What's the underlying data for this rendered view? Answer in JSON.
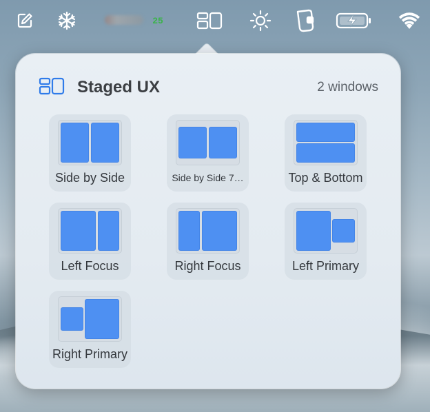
{
  "menubar": {
    "items": [
      {
        "name": "compose-icon"
      },
      {
        "name": "snowflake-icon"
      },
      {
        "name": "stats-text",
        "text": "25"
      },
      {
        "name": "staged-ux-icon"
      },
      {
        "name": "brightness-icon"
      },
      {
        "name": "phone-icon"
      },
      {
        "name": "battery-charging-icon"
      },
      {
        "name": "wifi-icon"
      }
    ],
    "stats_text": "25"
  },
  "popover": {
    "title": "Staged UX",
    "window_count": "2 windows",
    "icon": "staged-ux-icon"
  },
  "layouts": [
    {
      "label": "Side by Side",
      "icon": "side-by-side-layout"
    },
    {
      "label": "Side by Side 7…",
      "icon": "side-by-side-75-layout"
    },
    {
      "label": "Top & Bottom",
      "icon": "top-bottom-layout"
    },
    {
      "label": "Left Focus",
      "icon": "left-focus-layout"
    },
    {
      "label": "Right Focus",
      "icon": "right-focus-layout"
    },
    {
      "label": "Left Primary",
      "icon": "left-primary-layout"
    },
    {
      "label": "Right Primary",
      "icon": "right-primary-layout"
    }
  ],
  "colors": {
    "accent": "#4e90f2",
    "title_icon": "#2f7bea",
    "stats_green": "#3bb34a"
  }
}
